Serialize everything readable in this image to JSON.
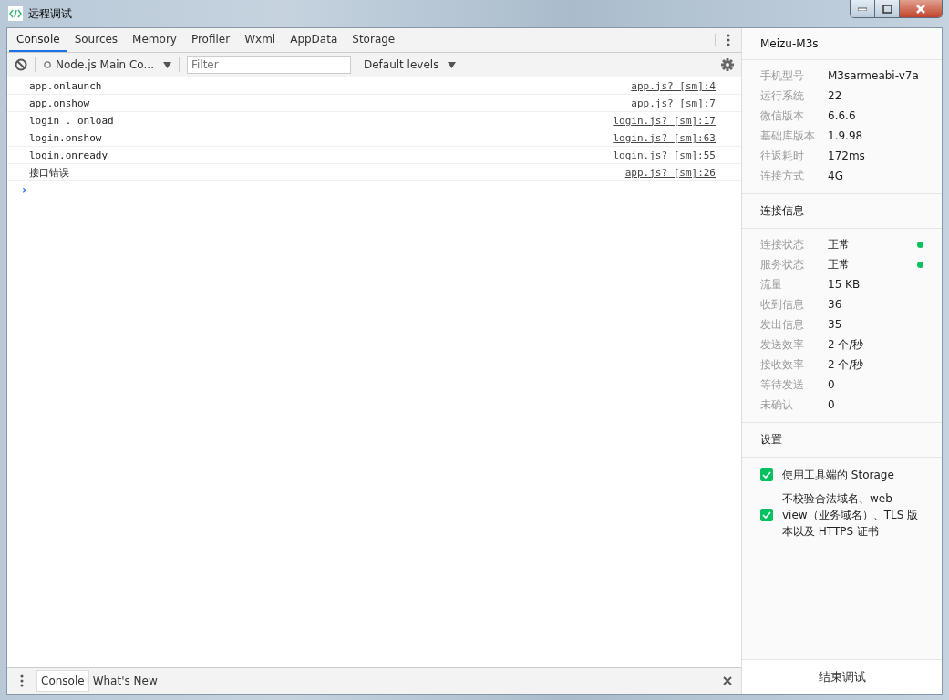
{
  "window": {
    "title": "远程调试"
  },
  "tabs": [
    {
      "label": "Console",
      "selected": true
    },
    {
      "label": "Sources",
      "selected": false
    },
    {
      "label": "Memory",
      "selected": false
    },
    {
      "label": "Profiler",
      "selected": false
    },
    {
      "label": "Wxml",
      "selected": false
    },
    {
      "label": "AppData",
      "selected": false
    },
    {
      "label": "Storage",
      "selected": false
    }
  ],
  "toolbar": {
    "context": "Node.js Main Co...",
    "filter_placeholder": "Filter",
    "levels": "Default levels"
  },
  "console_messages": [
    {
      "text": "app.onlaunch",
      "source": "app.js? [sm]:4"
    },
    {
      "text": "app.onshow",
      "source": "app.js? [sm]:7"
    },
    {
      "text": "login . onload",
      "source": "login.js? [sm]:17"
    },
    {
      "text": "login.onshow",
      "source": "login.js? [sm]:63"
    },
    {
      "text": "login.onready",
      "source": "login.js? [sm]:55"
    },
    {
      "text": "接口错误",
      "source": "app.js? [sm]:26"
    }
  ],
  "prompt": "›",
  "drawer_tabs": [
    {
      "label": "Console",
      "selected": true
    },
    {
      "label": "What's New",
      "selected": false
    }
  ],
  "device": {
    "name": "Meizu-M3s",
    "info": [
      {
        "label": "手机型号",
        "value": "M3sarmeabi-v7a"
      },
      {
        "label": "运行系统",
        "value": "22"
      },
      {
        "label": "微信版本",
        "value": "6.6.6"
      },
      {
        "label": "基础库版本",
        "value": "1.9.98"
      },
      {
        "label": "往返耗时",
        "value": "172ms"
      },
      {
        "label": "连接方式",
        "value": "4G"
      }
    ]
  },
  "connection": {
    "title": "连接信息",
    "info": [
      {
        "label": "连接状态",
        "value": "正常",
        "color": "#07c160"
      },
      {
        "label": "服务状态",
        "value": "正常",
        "color": "#07c160"
      },
      {
        "label": "流量",
        "value": "15 KB"
      },
      {
        "label": "收到信息",
        "value": "36"
      },
      {
        "label": "发出信息",
        "value": "35"
      },
      {
        "label": "发送效率",
        "value": "2 个/秒"
      },
      {
        "label": "接收效率",
        "value": "2 个/秒"
      },
      {
        "label": "等待发送",
        "value": "0"
      },
      {
        "label": "未确认",
        "value": "0"
      }
    ]
  },
  "settings": {
    "title": "设置",
    "options": [
      {
        "label": "使用工具端的 Storage",
        "checked": true
      },
      {
        "label": "不校验合法域名、web-view（业务域名）、TLS 版本以及 HTTPS 证书",
        "checked": true
      }
    ]
  },
  "end_button": "结束调试"
}
